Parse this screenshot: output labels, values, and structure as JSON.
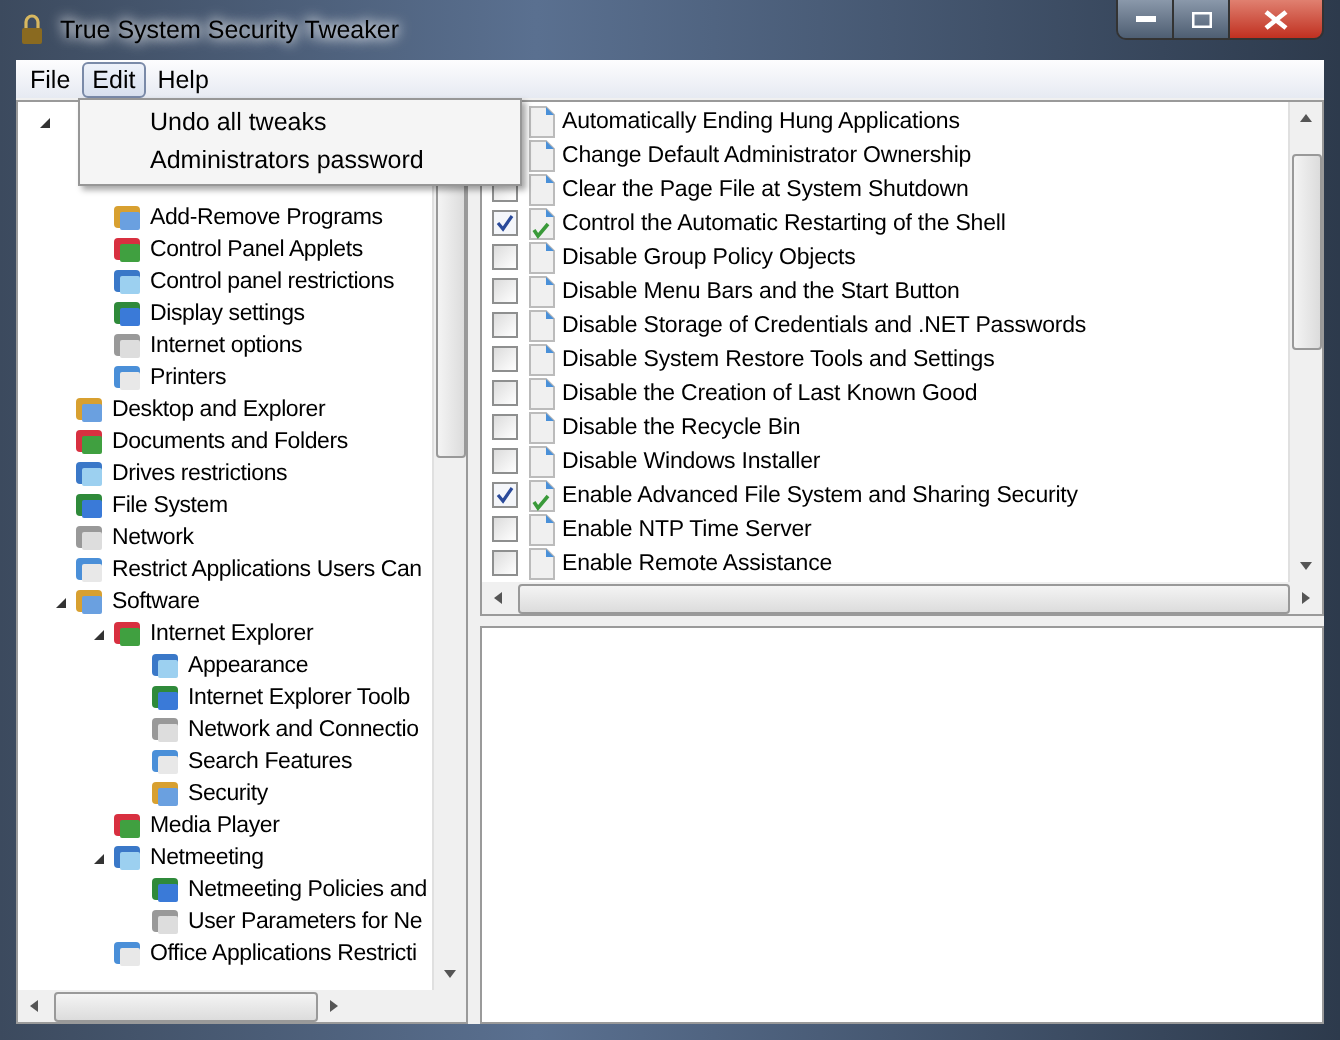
{
  "window": {
    "title": "True System Security Tweaker"
  },
  "menu_bar": [
    {
      "label": "File",
      "selected": false
    },
    {
      "label": "Edit",
      "selected": true
    },
    {
      "label": "Help",
      "selected": false
    }
  ],
  "open_menu": {
    "items": [
      "Undo all tweaks",
      "Administrators password"
    ]
  },
  "tree": {
    "children": [
      {
        "expanded": true,
        "children": [
          {
            "label": "Add-Remove Programs"
          },
          {
            "label": "Control Panel Applets"
          },
          {
            "label": "Control panel restrictions"
          },
          {
            "label": "Display settings"
          },
          {
            "label": "Internet options"
          },
          {
            "label": "Printers"
          }
        ]
      },
      {
        "label": "Desktop and Explorer"
      },
      {
        "label": "Documents and Folders"
      },
      {
        "label": "Drives restrictions"
      },
      {
        "label": "File System"
      },
      {
        "label": "Network"
      },
      {
        "label": "Restrict Applications Users Can"
      },
      {
        "label": "Software",
        "expanded": true,
        "children": [
          {
            "label": "Internet Explorer",
            "expanded": true,
            "children": [
              {
                "label": "Appearance"
              },
              {
                "label": "Internet Explorer Toolb"
              },
              {
                "label": "Network and Connectio"
              },
              {
                "label": "Search Features"
              },
              {
                "label": "Security"
              }
            ]
          },
          {
            "label": "Media Player"
          },
          {
            "label": "Netmeeting",
            "expanded": true,
            "children": [
              {
                "label": "Netmeeting Policies and"
              },
              {
                "label": "User Parameters for Ne"
              }
            ]
          },
          {
            "label": "Office Applications Restricti"
          }
        ]
      }
    ]
  },
  "tweaks": [
    {
      "label": "Automatically Ending Hung Applications"
    },
    {
      "label": "Change Default Administrator Ownership"
    },
    {
      "label": "Clear the Page File at System Shutdown",
      "checked": false
    },
    {
      "label": "Control the Automatic Restarting of the Shell",
      "checked": true
    },
    {
      "label": "Disable Group Policy Objects",
      "checked": false
    },
    {
      "label": "Disable Menu Bars and the Start Button",
      "checked": false
    },
    {
      "label": "Disable Storage of Credentials and .NET Passwords",
      "checked": false
    },
    {
      "label": "Disable System Restore Tools and Settings",
      "checked": false
    },
    {
      "label": "Disable the Creation of Last Known Good",
      "checked": false
    },
    {
      "label": "Disable the Recycle Bin",
      "checked": false
    },
    {
      "label": "Disable Windows Installer",
      "checked": false
    },
    {
      "label": "Enable Advanced File System and Sharing Security",
      "checked": true
    },
    {
      "label": "Enable NTP Time Server",
      "checked": false
    },
    {
      "label": "Enable Remote Assistance",
      "checked": false
    }
  ]
}
